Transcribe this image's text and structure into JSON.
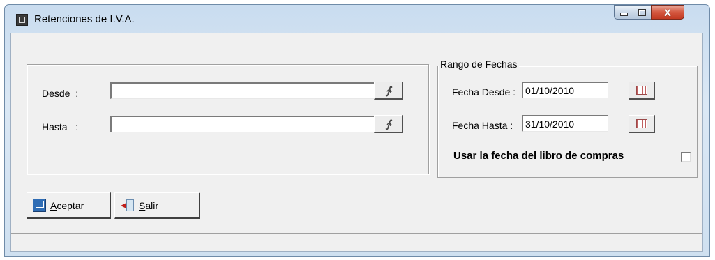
{
  "window": {
    "title": "Retenciones de I.V.A.",
    "controls": {
      "minimize": "minimize",
      "maximize": "maximize",
      "close": "X"
    }
  },
  "range_fields": {
    "desde_label": "Desde  :",
    "desde_value": "",
    "hasta_label": "Hasta   :",
    "hasta_value": ""
  },
  "date_range": {
    "group_title": "Rango de Fechas",
    "fecha_desde_label": "Fecha Desde :",
    "fecha_desde_value": "01/10/2010",
    "fecha_hasta_label": "Fecha Hasta :",
    "fecha_hasta_value": "31/10/2010",
    "usar_fecha_label": "Usar la fecha del libro de compras",
    "usar_fecha_checked": false
  },
  "buttons": {
    "aceptar_first": "A",
    "aceptar_rest": "ceptar",
    "salir_first": "S",
    "salir_rest": "alir"
  },
  "statusbar": {
    "text": ""
  }
}
